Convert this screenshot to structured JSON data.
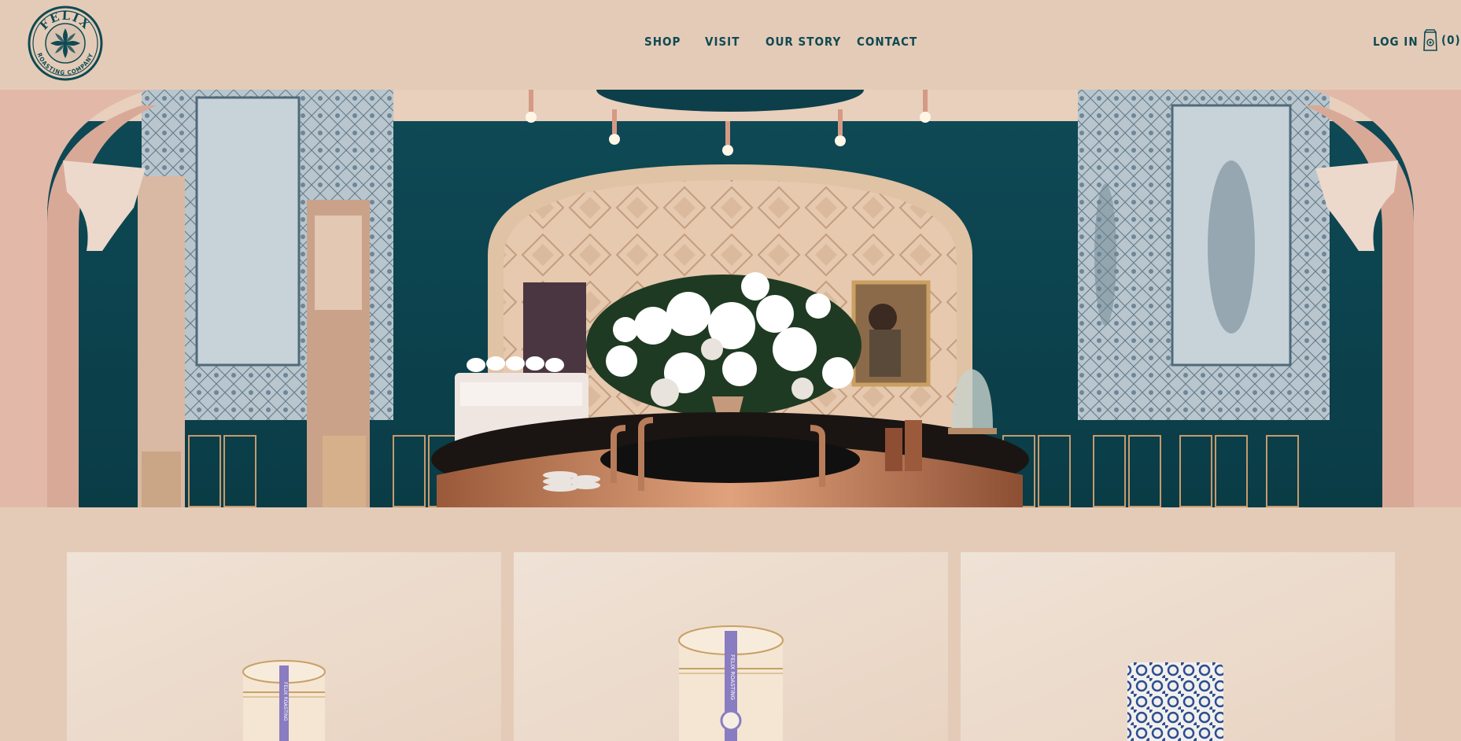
{
  "brand": {
    "logo_top_text": "FELIX",
    "logo_ring_text": "ROASTING COMPANY"
  },
  "nav": {
    "items": [
      {
        "label": "SHOP"
      },
      {
        "label": "VISIT"
      },
      {
        "label": "OUR STORY"
      },
      {
        "label": "CONTACT"
      }
    ]
  },
  "account": {
    "login_label": "LOG IN",
    "cart_count": "(0)"
  },
  "colors": {
    "background": "#e4cbb8",
    "brand_teal": "#0f4a52",
    "hero_wall_teal": "#0d4b57",
    "card_background": "#efe0d3"
  },
  "products": [
    {
      "tin_label": "FELIX ROASTING"
    },
    {
      "tin_label": "FELIX ROASTING"
    },
    {
      "package": "blue-patterned-bag"
    }
  ]
}
